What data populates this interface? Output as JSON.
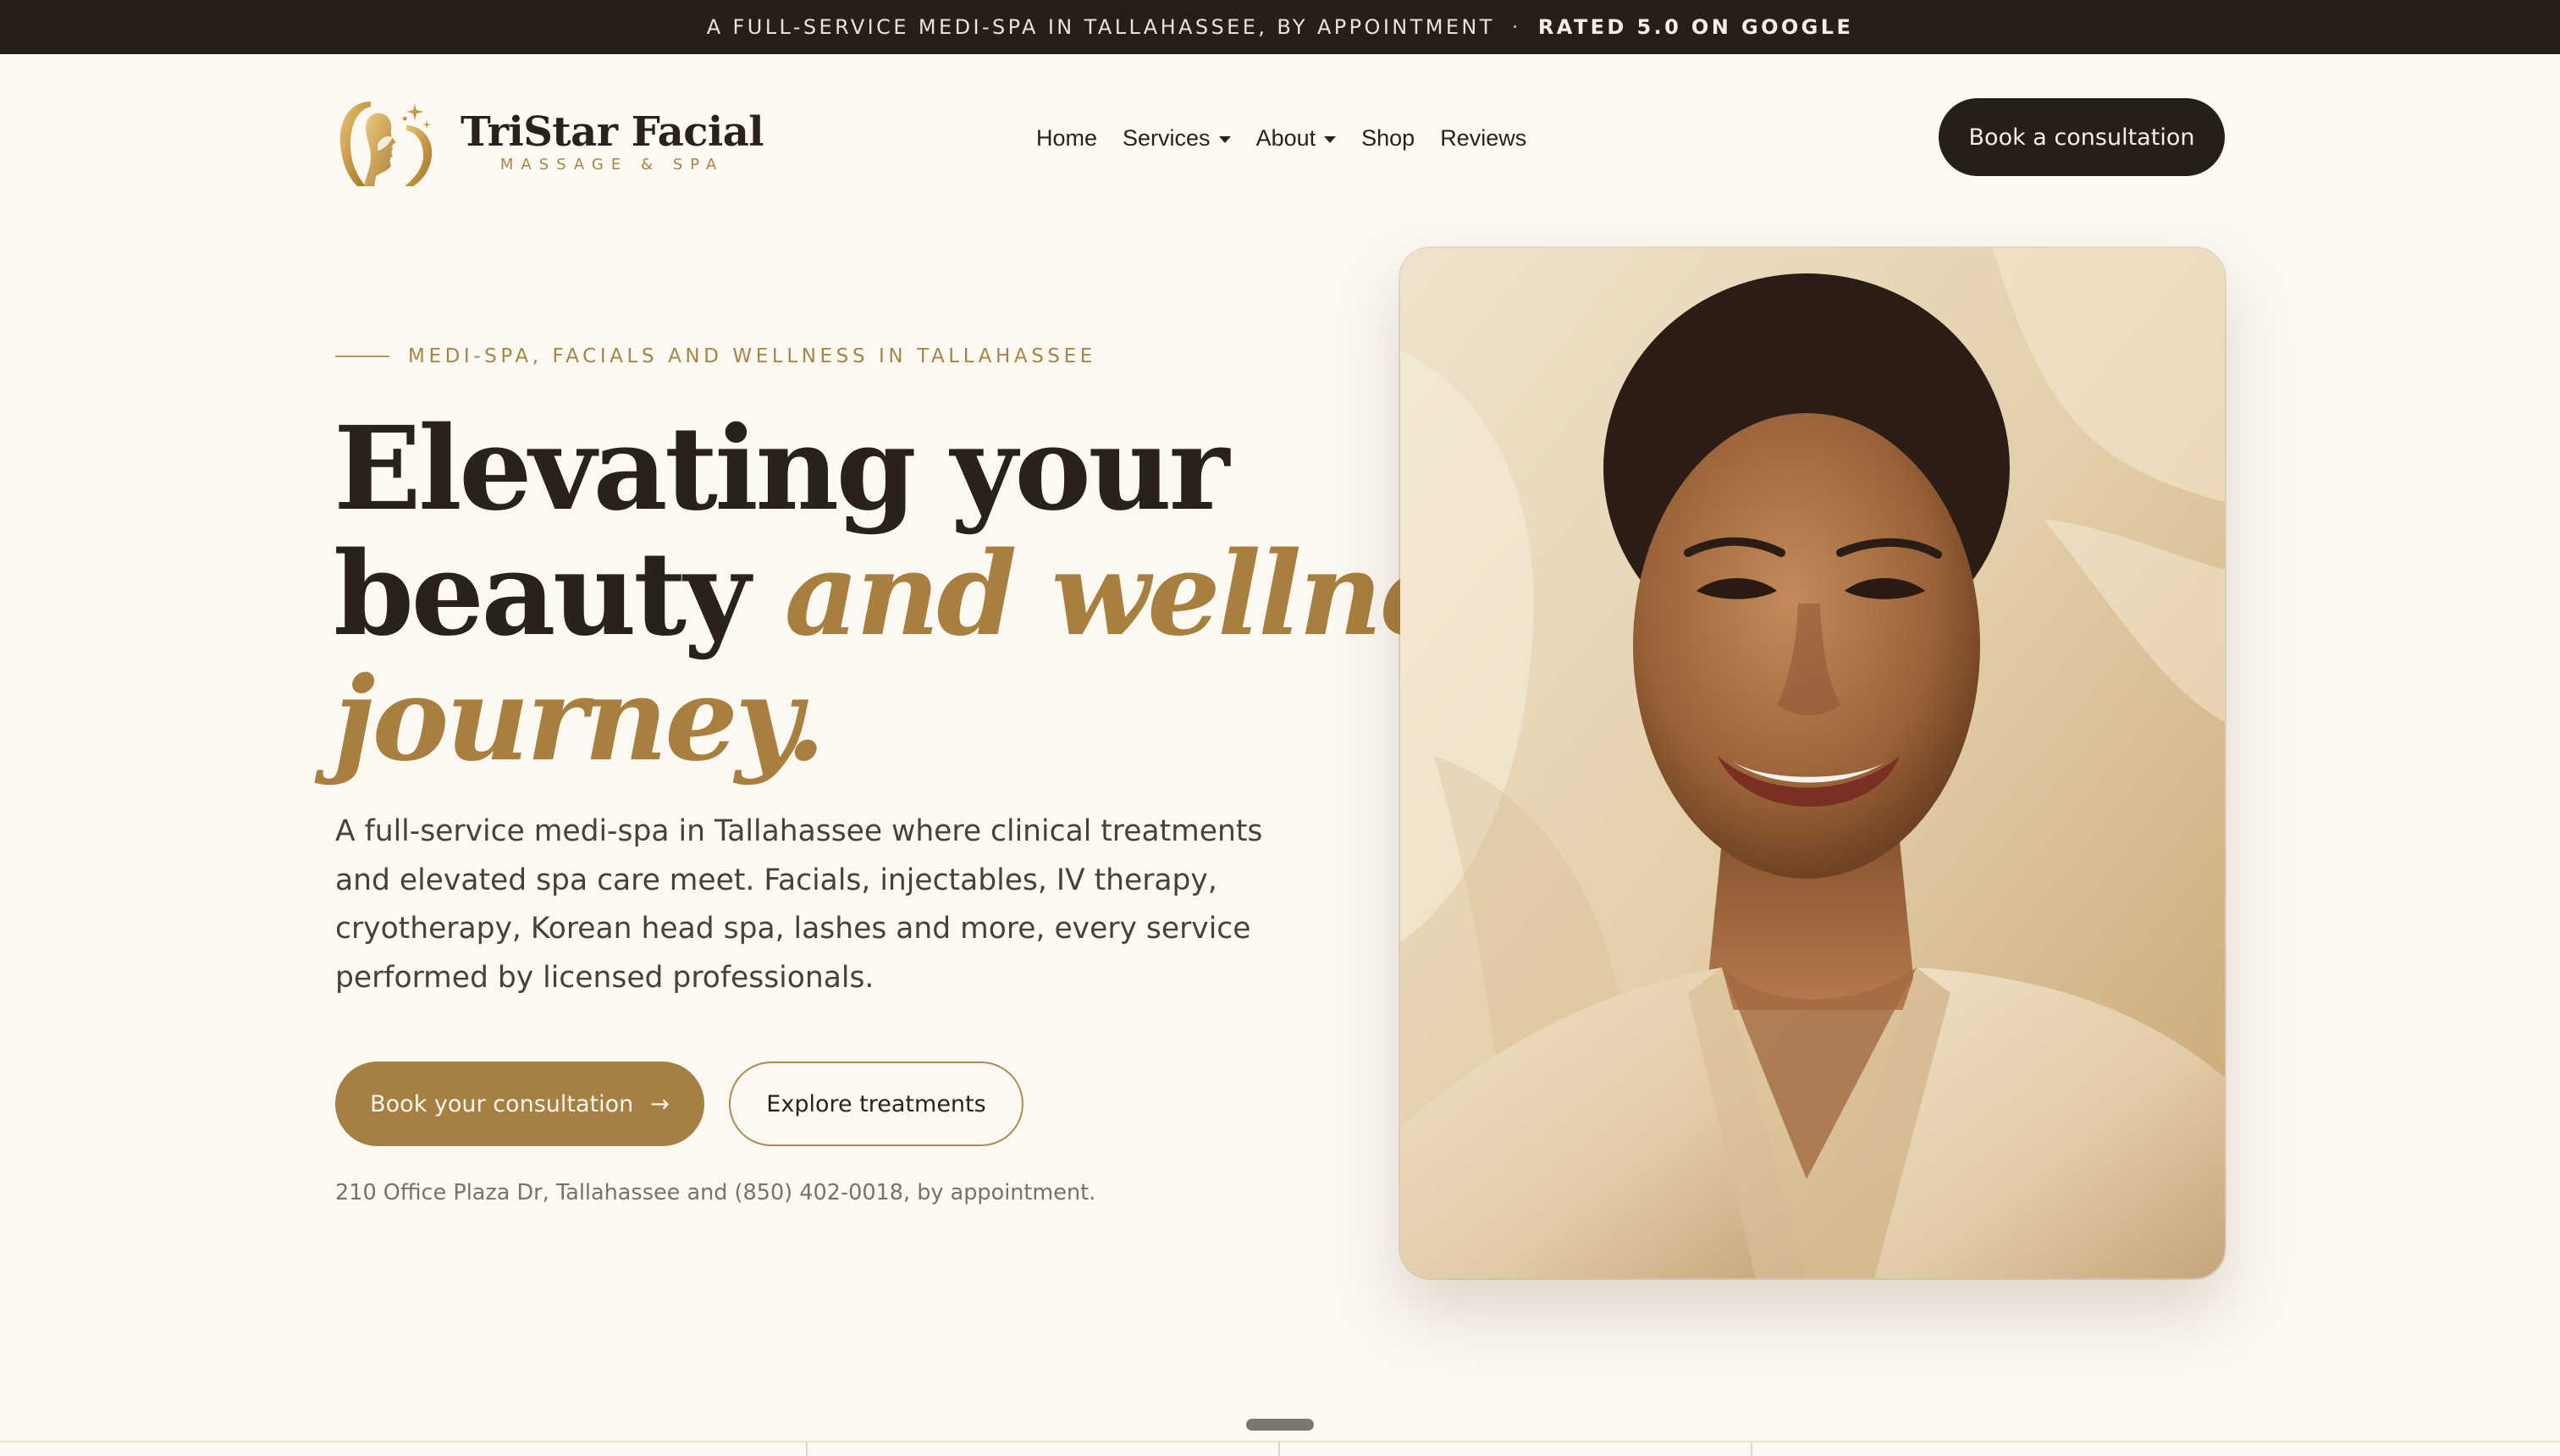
{
  "announcement": {
    "text": "A FULL-SERVICE MEDI-SPA IN TALLAHASSEE, BY APPOINTMENT",
    "separator": "·",
    "rating": "RATED 5.0 ON GOOGLE"
  },
  "brand": {
    "name": "TriStar Facial",
    "tagline": "MASSAGE & SPA",
    "icon": "face-silhouette-logo-icon"
  },
  "nav": {
    "items": [
      {
        "label": "Home",
        "has_dropdown": false
      },
      {
        "label": "Services",
        "has_dropdown": true
      },
      {
        "label": "About",
        "has_dropdown": true
      },
      {
        "label": "Shop",
        "has_dropdown": false
      },
      {
        "label": "Reviews",
        "has_dropdown": false
      }
    ],
    "cta_label": "Book a consultation"
  },
  "hero": {
    "eyebrow": "MEDI-SPA, FACIALS AND WELLNESS IN TALLAHASSEE",
    "headline": {
      "line1": "Elevating your",
      "line2_plain": "beauty ",
      "line2_accent": "and wellness",
      "line3_accent": "journey."
    },
    "lead": "A full-service medi-spa in Tallahassee where clinical treatments and elevated spa care meet. Facials, injectables, IV therapy, cryotherapy, Korean head spa, lashes and more, every service performed by licensed professionals.",
    "primary_button": "Book your consultation",
    "primary_button_icon": "→",
    "secondary_button": "Explore treatments",
    "address": "210 Office Plaza Dr, Tallahassee and (850) 402-0018, by appointment."
  },
  "colors": {
    "page_bg": "#fcf8f2",
    "dark": "#261e19",
    "gold": "#a87f3f",
    "text": "#2a211c",
    "muted": "#7b706a"
  }
}
